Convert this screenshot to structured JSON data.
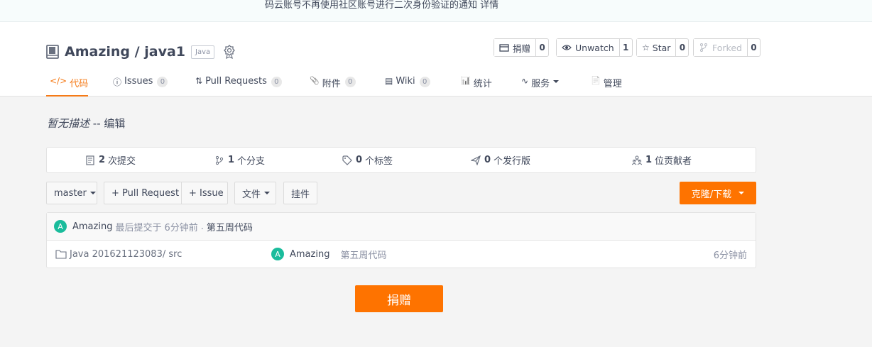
{
  "notice": {
    "text": "码云账号不再使用社区账号进行二次身份验证的通知",
    "link": "详情"
  },
  "repo": {
    "owner": "Amazing",
    "separator": "/",
    "name": "java1",
    "language": "Java"
  },
  "actions": {
    "donate": {
      "label": "捐赠",
      "count": "0"
    },
    "watch": {
      "label": "Unwatch",
      "count": "1"
    },
    "star": {
      "label": "Star",
      "count": "0"
    },
    "fork": {
      "label": "Forked",
      "count": "0"
    }
  },
  "tabs": [
    {
      "icon": "</>",
      "label": "代码",
      "active": true
    },
    {
      "icon": "ⓘ",
      "label": "Issues",
      "badge": "0"
    },
    {
      "icon": "⇅",
      "label": "Pull Requests",
      "badge": "0"
    },
    {
      "icon": "📎",
      "label": "附件",
      "badge": "0"
    },
    {
      "icon": "▤",
      "label": "Wiki",
      "badge": "0"
    },
    {
      "icon": "📊",
      "label": "统计"
    },
    {
      "icon": "∿",
      "label": "服务"
    },
    {
      "icon": "📄",
      "label": "管理"
    }
  ],
  "description": {
    "text": "暂无描述",
    "separator": "--",
    "edit": "编辑"
  },
  "stats": [
    {
      "icon": "commit-icon",
      "count": "2",
      "label": "次提交"
    },
    {
      "icon": "branch-icon",
      "count": "1",
      "label": "个分支"
    },
    {
      "icon": "tag-icon",
      "count": "0",
      "label": "个标签"
    },
    {
      "icon": "release-icon",
      "count": "0",
      "label": "个发行版"
    },
    {
      "icon": "contributors-icon",
      "count": "1",
      "label": "位贡献者"
    }
  ],
  "toolbar": {
    "branch": "master",
    "pull_request": "+ Pull Request",
    "issue": "+ Issue",
    "file": "文件",
    "widget": "挂件",
    "clone": "克隆/下载"
  },
  "latest_commit": {
    "avatar_letter": "A",
    "author": "Amazing",
    "text": "最后提交于",
    "time": "6分钟前",
    "separator": ".",
    "message": "第五周代码"
  },
  "files": [
    {
      "name": "Java 201621123083/ src",
      "avatar_letter": "A",
      "author": "Amazing",
      "message": "第五周代码",
      "time": "6分钟前"
    }
  ],
  "donate_button": "捐赠",
  "colors": {
    "accent": "#fe7300",
    "avatar": "#1abc9c"
  }
}
